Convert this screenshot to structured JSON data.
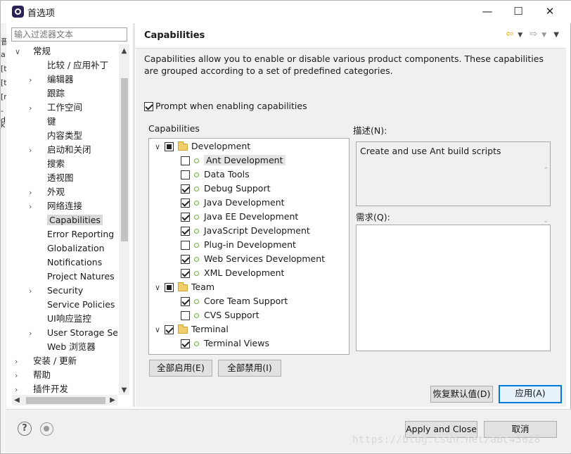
{
  "window": {
    "title": "首选项",
    "minimize": "—",
    "maximize": "☐",
    "close": "✕"
  },
  "left_strip_chars": [
    "晋",
    "a",
    "[t",
    "[t",
    "[r",
    "-d",
    "k"
  ],
  "sidebar": {
    "filter_placeholder": "输入过滤器文本",
    "items": [
      {
        "label": "常规",
        "arrow": "∨",
        "indent": 0
      },
      {
        "label": "比较 / 应用补丁",
        "arrow": "",
        "indent": 1
      },
      {
        "label": "编辑器",
        "arrow": "›",
        "indent": 1
      },
      {
        "label": "跟踪",
        "arrow": "",
        "indent": 1
      },
      {
        "label": "工作空间",
        "arrow": "›",
        "indent": 1
      },
      {
        "label": "键",
        "arrow": "",
        "indent": 1
      },
      {
        "label": "内容类型",
        "arrow": "",
        "indent": 1
      },
      {
        "label": "启动和关闭",
        "arrow": "›",
        "indent": 1
      },
      {
        "label": "搜索",
        "arrow": "",
        "indent": 1
      },
      {
        "label": "透视图",
        "arrow": "",
        "indent": 1
      },
      {
        "label": "外观",
        "arrow": "›",
        "indent": 1
      },
      {
        "label": "网络连接",
        "arrow": "›",
        "indent": 1
      },
      {
        "label": "Capabilities",
        "arrow": "",
        "indent": 1,
        "selected": true
      },
      {
        "label": "Error Reporting",
        "arrow": "",
        "indent": 1
      },
      {
        "label": "Globalization",
        "arrow": "",
        "indent": 1
      },
      {
        "label": "Notifications",
        "arrow": "",
        "indent": 1
      },
      {
        "label": "Project Natures",
        "arrow": "",
        "indent": 1
      },
      {
        "label": "Security",
        "arrow": "›",
        "indent": 1
      },
      {
        "label": "Service Policies",
        "arrow": "",
        "indent": 1
      },
      {
        "label": "UI响应监控",
        "arrow": "",
        "indent": 1
      },
      {
        "label": "User Storage Serv",
        "arrow": "›",
        "indent": 1
      },
      {
        "label": "Web 浏览器",
        "arrow": "",
        "indent": 1
      },
      {
        "label": "安装 / 更新",
        "arrow": "›",
        "indent": 0
      },
      {
        "label": "帮助",
        "arrow": "›",
        "indent": 0
      },
      {
        "label": "插件开发",
        "arrow": "›",
        "indent": 0
      }
    ]
  },
  "page": {
    "title": "Capabilities",
    "description": "Capabilities allow you to enable or disable various product components.  These capabilities are grouped according to a set of predefined categories.",
    "prompt_label": "Prompt when enabling capabilities",
    "prompt_checked": true,
    "capabilities_label": "Capabilities",
    "tree": [
      {
        "label": "Development",
        "type": "category",
        "state": "partial",
        "expanded": true
      },
      {
        "label": "Ant Development",
        "type": "item",
        "state": "off",
        "selected": true
      },
      {
        "label": "Data Tools",
        "type": "item",
        "state": "off"
      },
      {
        "label": "Debug Support",
        "type": "item",
        "state": "on"
      },
      {
        "label": "Java Development",
        "type": "item",
        "state": "on"
      },
      {
        "label": "Java EE Development",
        "type": "item",
        "state": "on"
      },
      {
        "label": "JavaScript Development",
        "type": "item",
        "state": "on"
      },
      {
        "label": "Plug-in Development",
        "type": "item",
        "state": "off"
      },
      {
        "label": "Web Services Development",
        "type": "item",
        "state": "on"
      },
      {
        "label": "XML Development",
        "type": "item",
        "state": "on"
      },
      {
        "label": "Team",
        "type": "category",
        "state": "partial",
        "expanded": true
      },
      {
        "label": "Core Team Support",
        "type": "item",
        "state": "on"
      },
      {
        "label": "CVS Support",
        "type": "item",
        "state": "off"
      },
      {
        "label": "Terminal",
        "type": "category",
        "state": "on",
        "expanded": true
      },
      {
        "label": "Terminal Views",
        "type": "item",
        "state": "on"
      }
    ],
    "desc_label": "描述(N):",
    "desc_text": "Create and use Ant build scripts",
    "req_label": "需求(Q):",
    "enable_all": "全部启用(E)",
    "disable_all": "全部禁用(I)",
    "restore_defaults": "恢复默认值(D)",
    "apply": "应用(A)"
  },
  "footer": {
    "apply_close": "Apply and Close",
    "cancel": "取消"
  },
  "watermark": "https://blog.csdn.net/abc45628"
}
